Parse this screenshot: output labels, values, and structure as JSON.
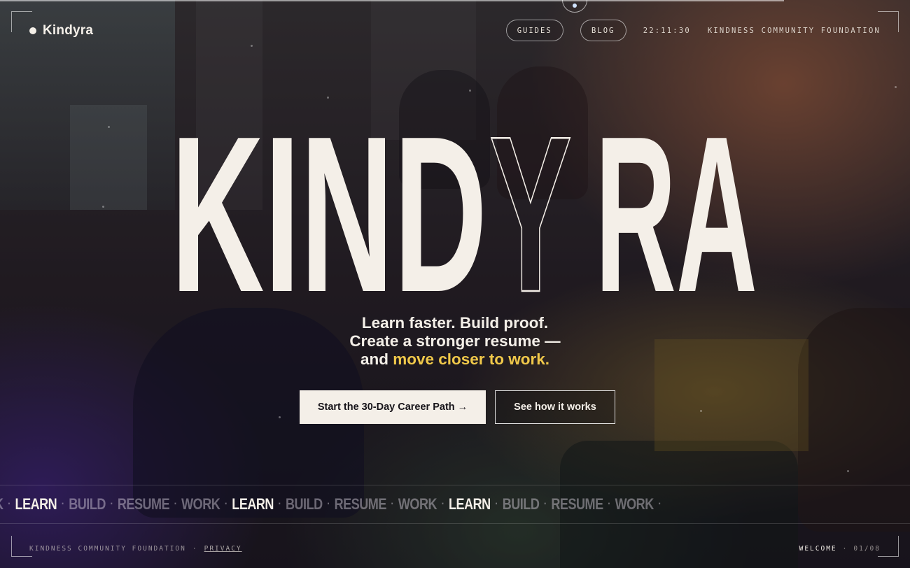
{
  "header": {
    "brand": "Kindyra",
    "nav": [
      {
        "label": "GUIDES"
      },
      {
        "label": "BLOG"
      }
    ],
    "clock": "22:11:30",
    "org": "KINDNESS COMMUNITY FOUNDATION"
  },
  "hero": {
    "wordmark_start": "KIND",
    "wordmark_outline": "Y",
    "wordmark_end": "RA",
    "tagline_line1": "Learn faster. Build proof.",
    "tagline_line2": "Create a stronger resume —",
    "tagline_line3_prefix": "and ",
    "tagline_line3_accent": "move closer to work.",
    "cta_primary": "Start the 30-Day Career Path →",
    "cta_secondary": "See how it works"
  },
  "marquee": {
    "items": [
      "K",
      "LEARN",
      "BUILD",
      "RESUME",
      "WORK",
      "LEARN",
      "BUILD",
      "RESUME",
      "WORK",
      "LEARN",
      "BUILD",
      "RESUME",
      "WORK"
    ],
    "separator": "·"
  },
  "footer": {
    "org": "KINDNESS COMMUNITY FOUNDATION",
    "separator": "·",
    "privacy": "PRIVACY",
    "section": "WELCOME",
    "page": "01/08"
  },
  "colors": {
    "cream": "#f4efe8",
    "accent_yellow": "#f0c84a",
    "dark": "#17141a"
  }
}
